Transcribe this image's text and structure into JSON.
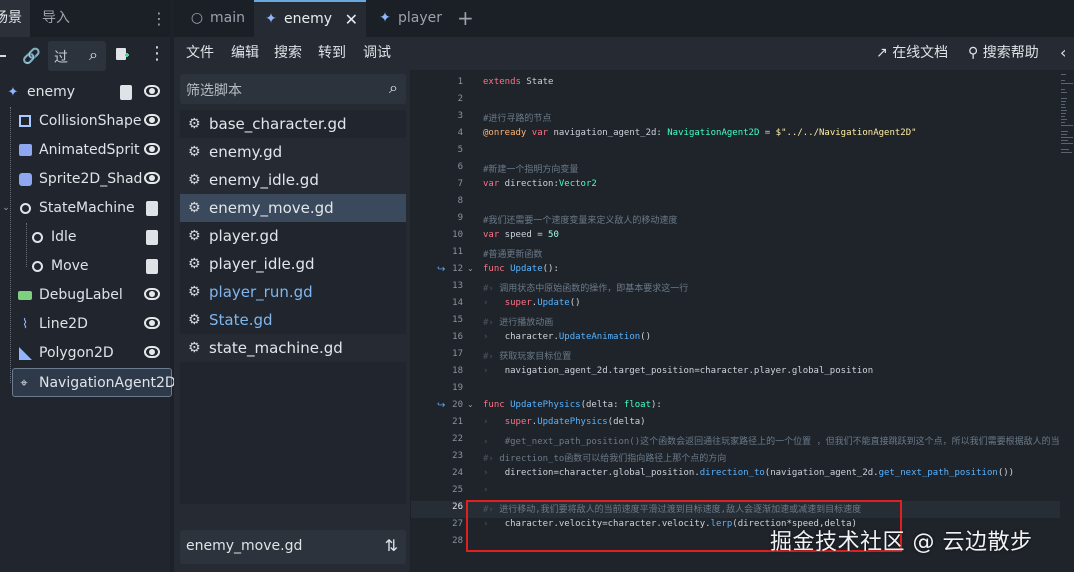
{
  "scene_dock": {
    "tabs": [
      "场景",
      "导入"
    ],
    "filter_placeholder": "过",
    "nodes": [
      {
        "name": "enemy",
        "icon": "character-body-icon",
        "indent": 0,
        "script": true,
        "eye": true
      },
      {
        "name": "CollisionShape",
        "icon": "collision-shape-icon",
        "indent": 1,
        "script": false,
        "eye": true
      },
      {
        "name": "AnimatedSprit",
        "icon": "animated-sprite-icon",
        "indent": 1,
        "script": false,
        "eye": true
      },
      {
        "name": "Sprite2D_Shad",
        "icon": "sprite-icon",
        "indent": 1,
        "script": false,
        "eye": true
      },
      {
        "name": "StateMachine",
        "icon": "node-circle-icon",
        "indent": 1,
        "script": true,
        "eye": false
      },
      {
        "name": "Idle",
        "icon": "node-circle-icon",
        "indent": 2,
        "script": true,
        "eye": false
      },
      {
        "name": "Move",
        "icon": "node-circle-icon",
        "indent": 2,
        "script": true,
        "eye": false
      },
      {
        "name": "DebugLabel",
        "icon": "label-icon",
        "indent": 1,
        "script": false,
        "eye": true
      },
      {
        "name": "Line2D",
        "icon": "line-icon",
        "indent": 1,
        "script": false,
        "eye": true
      },
      {
        "name": "Polygon2D",
        "icon": "polygon-icon",
        "indent": 1,
        "script": false,
        "eye": true
      },
      {
        "name": "NavigationAgent2D",
        "icon": "navigation-agent-icon",
        "indent": 1,
        "script": false,
        "eye": false,
        "selected": true
      }
    ]
  },
  "editor_tabs": [
    {
      "label": "main",
      "icon": "node-circle-icon"
    },
    {
      "label": "enemy",
      "icon": "character-body-icon",
      "active": true
    },
    {
      "label": "player",
      "icon": "character-body-icon"
    }
  ],
  "menubar": {
    "items": [
      "文件",
      "编辑",
      "搜索",
      "转到",
      "调试"
    ],
    "online_docs": "在线文档",
    "search_help": "搜索帮助"
  },
  "script_panel": {
    "filter_placeholder": "筛选脚本",
    "scripts": [
      {
        "name": "base_character.gd",
        "style": "normal"
      },
      {
        "name": "enemy.gd",
        "style": "dim"
      },
      {
        "name": "enemy_idle.gd",
        "style": "dim"
      },
      {
        "name": "enemy_move.gd",
        "style": "selected"
      },
      {
        "name": "player.gd",
        "style": "normal"
      },
      {
        "name": "player_idle.gd",
        "style": "normal"
      },
      {
        "name": "player_run.gd",
        "style": "blue"
      },
      {
        "name": "State.gd",
        "style": "blue"
      },
      {
        "name": "state_machine.gd",
        "style": "dim"
      }
    ],
    "current_script": "enemy_move.gd"
  },
  "code": {
    "lines": [
      "extends State",
      "",
      "#进行寻路的节点",
      "@onready var navigation_agent_2d: NavigationAgent2D = $\"../../NavigationAgent2D\"",
      "",
      "#新建一个指明方向变量",
      "var direction:Vector2",
      "",
      "#我们还需要一个速度变量来定义敌人的移动速度",
      "var speed = 50",
      "#普通更新函数",
      "func Update():",
      "调用状态中原始函数的操作，即基本要求这一行",
      "super.Update()",
      "进行播放动画",
      "character.UpdateAnimation()",
      "获取玩家目标位置",
      "navigation_agent_2d.target_position=character.player.global_position",
      "",
      "func UpdatePhysics(delta: float):",
      "super.UpdatePhysics(delta)",
      "#get_next_path_position()这个函数会返回通往玩家路径上的一个位置 ，但我们不能直接跳跃到这个点，所以我们需要根据敌人的当",
      "direction_to函数可以给我们指向路径上那个点的方向",
      "direction=character.global_position.direction_to(navigation_agent_2d.get_next_path_position())",
      "",
      "进行移动,我们要将敌人的当前速度平滑过渡到目标速度,敌人会逐渐加速或减速到目标速度",
      "character.velocity=character.velocity.lerp(direction*speed,delta)",
      ""
    ],
    "current_line": 26,
    "fold_lines": [
      12,
      20
    ]
  },
  "watermark": "掘金技术社区 @ 云边散步",
  "colors": {
    "keyword": "#ff7085",
    "comment": "#6b7a88",
    "type": "#42ffc2",
    "function": "#57b3ff",
    "string": "#ffeda1",
    "number": "#a1ffe0",
    "annotation": "#ffb373",
    "highlight_box": "#e0201e",
    "selection": "#3a4a5c"
  }
}
